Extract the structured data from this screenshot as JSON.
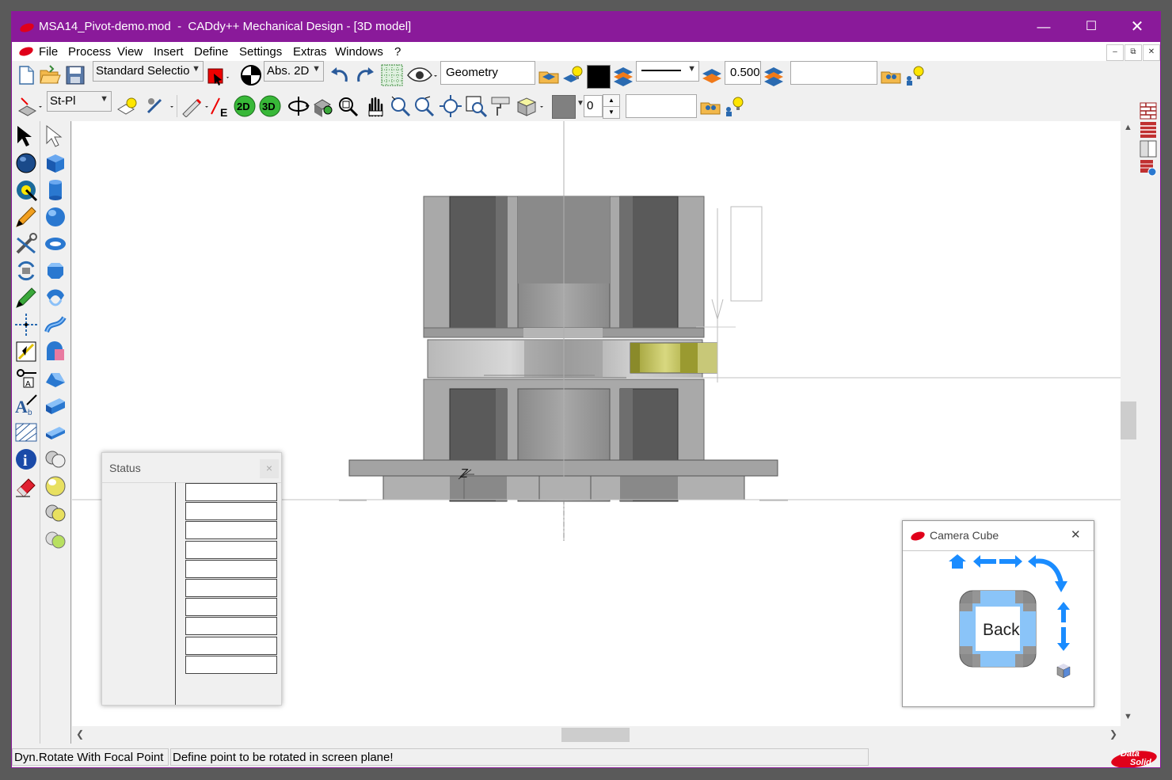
{
  "window": {
    "title": "MSA14_Pivot-demo.mod  -  CADdy++ Mechanical Design - [3D model]",
    "accent_color": "#8a1a9a"
  },
  "menu": {
    "items": [
      "File",
      "Process",
      "View",
      "Insert",
      "Define",
      "Settings",
      "Extras",
      "Windows",
      "?"
    ]
  },
  "toolbar1": {
    "selection_mode": "Standard Selectio",
    "coord_mode": "Abs. 2D",
    "layer_name": "Geometry",
    "line_width": "0.500",
    "search_value": "",
    "color_swatch": "#000000"
  },
  "toolbar2": {
    "plane_combo": "St-Pl",
    "btn_2d": "2D",
    "btn_3d": "3D",
    "spin_value": "0",
    "text_value": "",
    "shade_color": "#808080"
  },
  "status_panel": {
    "title": "Status",
    "close_label": "×",
    "rows": 10
  },
  "camera_cube": {
    "title": "Camera Cube",
    "close_label": "✕",
    "face_label": "Back",
    "arrow_color": "#1a8cff"
  },
  "statusbar": {
    "command": "Dyn.Rotate With Focal Point",
    "prompt": "Define point to be rotated in screen plane!",
    "brand_top": "Data",
    "brand_bottom": "Solid"
  },
  "viewport": {
    "axis_label": "Z"
  }
}
